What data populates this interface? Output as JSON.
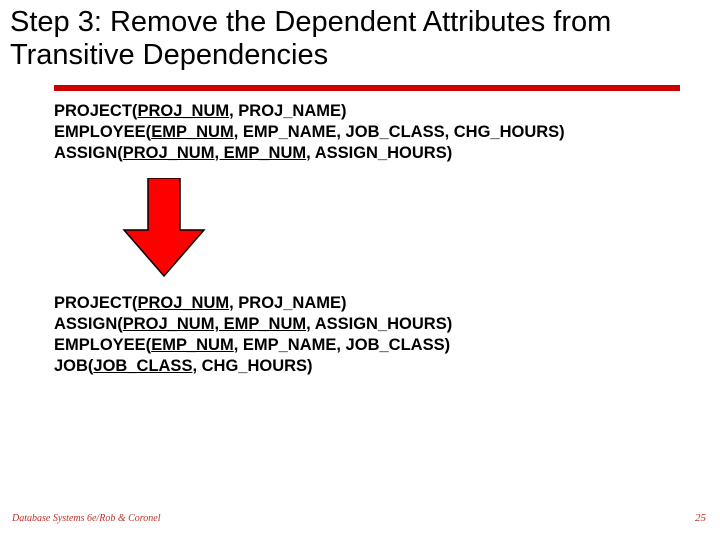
{
  "title": "Step 3: Remove the Dependent Attributes from Transitive Dependencies",
  "before": {
    "r0": {
      "name": "PROJECT(",
      "k0": "PROJ_NUM",
      "rest": ", PROJ_NAME)"
    },
    "r1": {
      "name": "EMPLOYEE(",
      "k0": "EMP_NUM",
      "rest": ", EMP_NAME, JOB_CLASS, CHG_HOURS)"
    },
    "r2": {
      "name": "ASSIGN(",
      "k0": "PROJ_NUM, EMP_NUM",
      "rest": ", ASSIGN_HOURS)"
    }
  },
  "after": {
    "r0": {
      "name": "PROJECT(",
      "k0": "PROJ_NUM",
      "rest": ", PROJ_NAME)"
    },
    "r1": {
      "name": "ASSIGN(",
      "k0": "PROJ_NUM, EMP_NUM",
      "rest": ", ASSIGN_HOURS)"
    },
    "r2": {
      "name": "EMPLOYEE(",
      "k0": "EMP_NUM",
      "rest": ", EMP_NAME, JOB_CLASS)"
    },
    "r3": {
      "name": "JOB(",
      "k0": "JOB_CLASS",
      "rest": ", CHG_HOURS)"
    }
  },
  "footer": {
    "left": "Database Systems 6e/Rob & Coronel",
    "right": "25"
  },
  "colors": {
    "accent": "#cc0000"
  }
}
